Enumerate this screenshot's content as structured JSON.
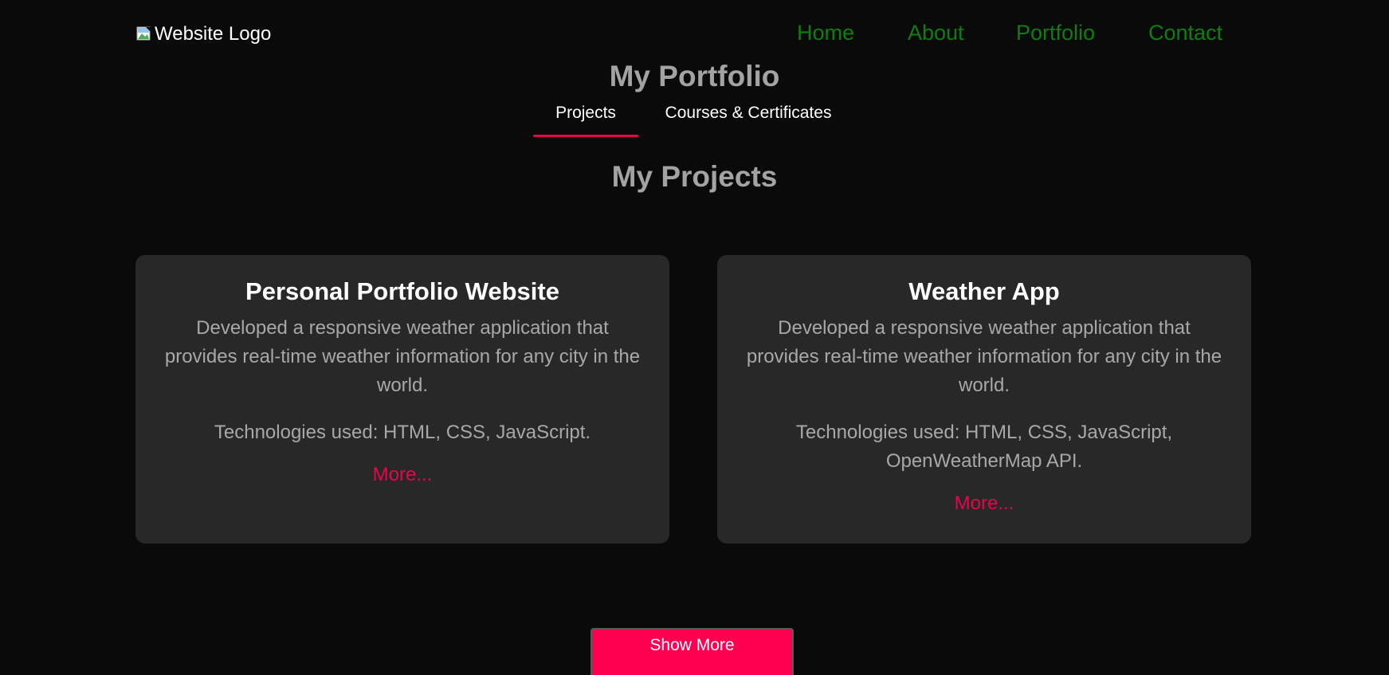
{
  "header": {
    "logo_alt": "Website Logo",
    "nav": {
      "home": "Home",
      "about": "About",
      "portfolio": "Portfolio",
      "contact": "Contact"
    }
  },
  "portfolio": {
    "title": "My Portfolio",
    "tabs": {
      "projects": "Projects",
      "courses": "Courses & Certificates"
    },
    "active_tab": "Projects",
    "section_title": "My Projects"
  },
  "projects": [
    {
      "title": "Personal Portfolio Website",
      "description": "Developed a responsive weather application that provides real-time weather information for any city in the world.",
      "technologies": "Technologies used: HTML, CSS, JavaScript.",
      "more": "More..."
    },
    {
      "title": "Weather App",
      "description": "Developed a responsive weather application that provides real-time weather information for any city in the world.",
      "technologies": "Technologies used: HTML, CSS, JavaScript, OpenWeatherMap API.",
      "more": "More..."
    }
  ],
  "show_more_label": "Show More",
  "colors": {
    "background": "#0a0a0a",
    "card": "#282828",
    "accent": "#ff0051",
    "nav_link": "#0f7d12",
    "heading": "#a3a3a3"
  }
}
